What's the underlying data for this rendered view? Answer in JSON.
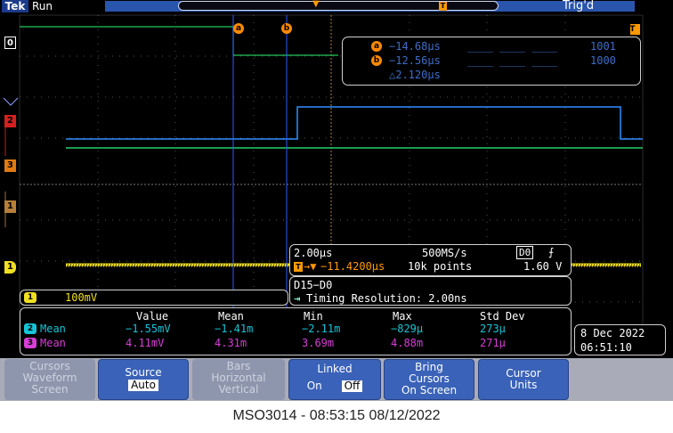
{
  "top_bar": {
    "brand": "Tek",
    "run_status": "Run",
    "trigger_status": "Trig'd",
    "trigger_marker": "▼",
    "trigger_T": "T"
  },
  "channel_markers": [
    {
      "label": "0",
      "color": "#ffffff"
    },
    {
      "label": "2",
      "color": "#d62020"
    },
    {
      "label": "3",
      "color": "#e07a10"
    },
    {
      "label": "1",
      "color": "#b87f3a"
    },
    {
      "label": "1",
      "color": "#f0e020"
    }
  ],
  "cursors": {
    "a_label": "a",
    "b_label": "b",
    "rows": [
      {
        "label": "a",
        "time": "−14.68µs",
        "dashes": "____ ____ ____",
        "value": "1001"
      },
      {
        "label": "b",
        "time": "−12.56µs",
        "dashes": "____ ____ ____",
        "value": "1000"
      }
    ],
    "delta": "△2.120µs"
  },
  "timebase": {
    "scale": "2.00µs",
    "sample_rate": "500MS/s",
    "trigger_source": "D0",
    "trigger_slope": "⨍",
    "position": "−11.4200µs",
    "record_length": "10k points",
    "trigger_level": "1.60 V"
  },
  "bus": {
    "name": "D15−D0",
    "timing_resolution": "Timing Resolution: 2.00ns"
  },
  "ch1_scale": {
    "channel": "1",
    "value": "100mV"
  },
  "measurements": {
    "headers": [
      "Value",
      "Mean",
      "Min",
      "Max",
      "Std Dev"
    ],
    "rows": [
      {
        "channel": "2",
        "name": "Mean",
        "value": "−1.55mV",
        "mean": "−1.41m",
        "min": "−2.11m",
        "max": "−829µ",
        "std_dev": "273µ",
        "color": "#16c4d6"
      },
      {
        "channel": "3",
        "name": "Mean",
        "value": "4.11mV",
        "mean": "4.31m",
        "min": "3.69m",
        "max": "4.88m",
        "std_dev": "271µ",
        "color": "#d63fd6"
      }
    ]
  },
  "datetime": {
    "date": "8 Dec 2022",
    "time": "06:51:10"
  },
  "menu": {
    "cursors": "Cursors\nWaveform\nScreen",
    "source_title": "Source",
    "source_value": "Auto",
    "bars": "Bars\nHorizontal\nVertical",
    "linked_title": "Linked",
    "linked_on": "On",
    "linked_off": "Off",
    "bring": "Bring\nCursors\nOn Screen",
    "units": "Cursor\nUnits"
  },
  "caption": "MSO3014 - 08:53:15   08/12/2022",
  "colors": {
    "ch1": "#f0e020",
    "ch2": "#1f8fff",
    "ch3": "#22d06a",
    "cursor": "#ff8a00",
    "accent": "#3a62b8"
  }
}
